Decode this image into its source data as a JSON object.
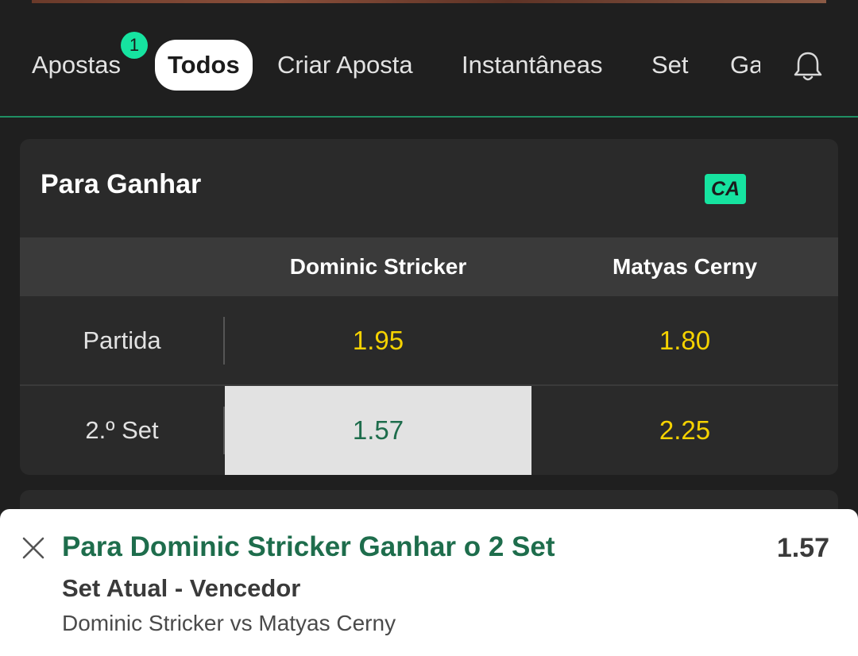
{
  "tabs": [
    {
      "label": "Apostas",
      "badge": "1"
    },
    {
      "label": "Todos",
      "active": true
    },
    {
      "label": "Criar Aposta"
    },
    {
      "label": "Instantâneas"
    },
    {
      "label": "Set"
    },
    {
      "label": "Ga"
    }
  ],
  "header_icons": [
    "bell-icon"
  ],
  "market": {
    "title": "Para Ganhar",
    "badge": "CA",
    "players": [
      "Dominic Stricker",
      "Matyas Cerny"
    ],
    "rows": [
      {
        "label": "Partida",
        "odds": [
          "1.95",
          "1.80"
        ]
      },
      {
        "label": "2.º Set",
        "odds": [
          "1.57",
          "2.25"
        ],
        "selected_index": 0
      }
    ]
  },
  "betslip": {
    "selection": "Para Dominic Stricker Ganhar o 2 Set",
    "odd": "1.57",
    "market": "Set Atual - Vencedor",
    "event": "Dominic Stricker vs Matyas Cerny",
    "close_icon": "close-icon"
  },
  "colors": {
    "background": "#1f1f1f",
    "card": "#2a2a2a",
    "accent_green": "#16e3a0",
    "odds_yellow": "#f5d200",
    "selected_text": "#1e6d4c"
  }
}
